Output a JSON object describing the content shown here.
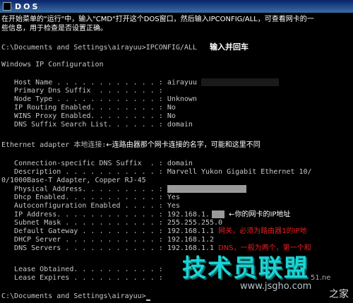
{
  "window": {
    "title": "DOS"
  },
  "intro": {
    "line1": "在开始菜单的\"运行\"中，输入\"CMD\"打开这个DOS窗口，然后输入IPCONFIG/ALL，可查看网卡的一",
    "line2": "些信息，用于检查是否设置正确。"
  },
  "command": {
    "prompt": "C:\\Documents and Settings\\airayuu>",
    "text": "IPCONFIG/ALL",
    "note": "输入并回车"
  },
  "header": "Windows IP Configuration",
  "ip_config": [
    {
      "label": "   Host Name . . . . . . . . . . . . :",
      "value": "airayuu"
    },
    {
      "label": "   Primary Dns Suffix  . . . . . . . :",
      "value": ""
    },
    {
      "label": "   Node Type . . . . . . . . . . . . :",
      "value": "Unknown"
    },
    {
      "label": "   IP Routing Enabled. . . . . . . . :",
      "value": "No"
    },
    {
      "label": "   WINS Proxy Enabled. . . . . . . . :",
      "value": "No"
    },
    {
      "label": "   DNS Suffix Search List. . . . . . :",
      "value": "domain"
    }
  ],
  "adapter": {
    "prefix": "Ethernet adapter ",
    "name": "本地连接",
    "suffix": ":",
    "note": "←连路由器那个网卡连接的名字，可能和这里不同"
  },
  "adapter_config": {
    "conn_suffix": {
      "label": "   Connection-specific DNS Suffix  . :",
      "value": "domain"
    },
    "description": {
      "label": "   Description . . . . . . . . . . . :",
      "value": "Marvell Yukon Gigabit Ethernet 10/"
    },
    "description_cont": "0/1000Base-T Adapter, Copper RJ-45",
    "physical": {
      "label": "   Physical Address. . . . . . . . . :",
      "value": ""
    },
    "dhcp": {
      "label": "   Dhcp Enabled. . . . . . . . . . . :",
      "value": "Yes"
    },
    "autoconf": {
      "label": "   Autoconfiguration Enabled . . . . :",
      "value": "Yes"
    },
    "ip": {
      "label": "   IP Address. . . . . . . . . . . . :",
      "value": "192.168.1.",
      "note": "←你的网卡的IP地址"
    },
    "subnet": {
      "label": "   Subnet Mask . . . . . . . . . . . :",
      "value": "255.255.255.0"
    },
    "gateway": {
      "label": "   Default Gateway . . . . . . . . . :",
      "value": "192.168.1.1",
      "note": "网关，必须为路由器1的IP地"
    },
    "dhcp_server": {
      "label": "   DHCP Server . . . . . . . . . . . :",
      "value": "192.168.1.2"
    },
    "dns": {
      "label": "   DNS Servers . . . . . . . . . . . :",
      "value": "192.168.1.1",
      "note": "DNS，一般为两个，第一个和"
    },
    "lease_obtained": {
      "label": "   Lease Obtained. . . . . . . . . . :",
      "value": ""
    },
    "lease_expires": {
      "label": "   Lease Expires . . . . . . . . . . :",
      "value": ""
    }
  },
  "final_prompt": "C:\\Documents and Settings\\airayuu>",
  "watermark": {
    "brand": "技术员联盟",
    "url": "www.jsgho.com",
    "tag": "51.ne",
    "corner": "之家"
  },
  "colors": {
    "titlebar": "#0a246a",
    "console_bg": "#000000",
    "console_text": "#c8c8c8",
    "note_red": "#e82020",
    "watermark": "#1bd4d4"
  }
}
